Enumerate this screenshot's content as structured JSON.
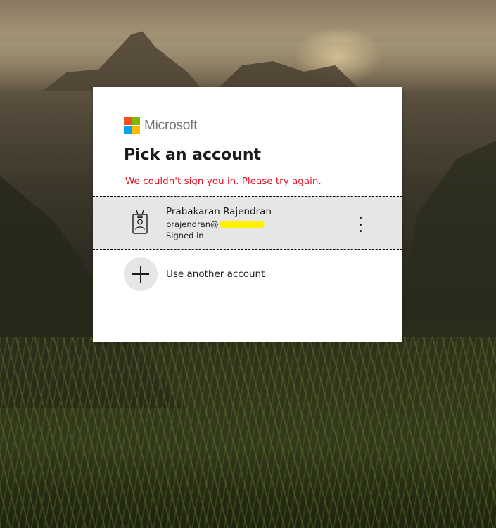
{
  "brand": {
    "name": "Microsoft",
    "colors": [
      "#f25022",
      "#7fba00",
      "#00a4ef",
      "#ffb900"
    ]
  },
  "heading": "Pick an account",
  "error_message": "We couldn't sign you in. Please try again.",
  "accounts": [
    {
      "name": "Prabakaran Rajendran",
      "email_visible": "prajendran@",
      "email_redacted": true,
      "status": "Signed in",
      "icon": "account-badge-icon"
    }
  ],
  "use_another_account": {
    "label": "Use another account",
    "icon": "plus-icon"
  },
  "colors": {
    "error": "#e81123",
    "selected_row_bg": "#e6e6e6",
    "redaction_highlight": "#fff200"
  }
}
